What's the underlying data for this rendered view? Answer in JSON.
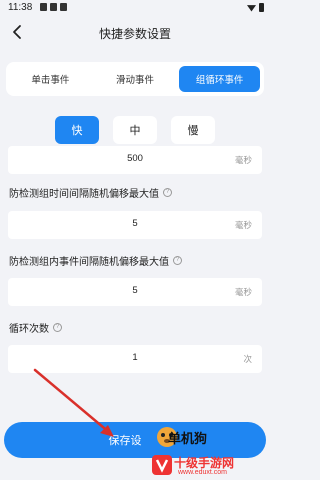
{
  "status_bar": {
    "time": "11:38"
  },
  "nav": {
    "title": "快捷参数设置"
  },
  "tabs": [
    {
      "label": "单击事件",
      "active": false
    },
    {
      "label": "滑动事件",
      "active": false
    },
    {
      "label": "组循环事件",
      "active": true
    }
  ],
  "speed": [
    {
      "label": "快",
      "active": true
    },
    {
      "label": "中",
      "active": false
    },
    {
      "label": "慢",
      "active": false
    }
  ],
  "fields": {
    "first": {
      "value": "500",
      "unit": "毫秒"
    },
    "group_interval": {
      "label": "防检测组时间间隔随机偏移最大值",
      "value": "5",
      "unit": "毫秒"
    },
    "event_interval": {
      "label": "防检测组内事件间隔随机偏移最大值",
      "value": "5",
      "unit": "毫秒"
    },
    "loop_count": {
      "label": "循环次数",
      "value": "1",
      "unit": "次"
    }
  },
  "help_glyph": "?",
  "save_button": {
    "label": "保存设"
  },
  "watermarks": {
    "brand1": "单机狗",
    "brand2": "十级手游网",
    "url": "www.eduxt.com"
  },
  "colors": {
    "accent": "#1f86f2",
    "background": "#f2f3f7",
    "watermark_red": "#e33",
    "arrow_red": "#d9302b"
  }
}
